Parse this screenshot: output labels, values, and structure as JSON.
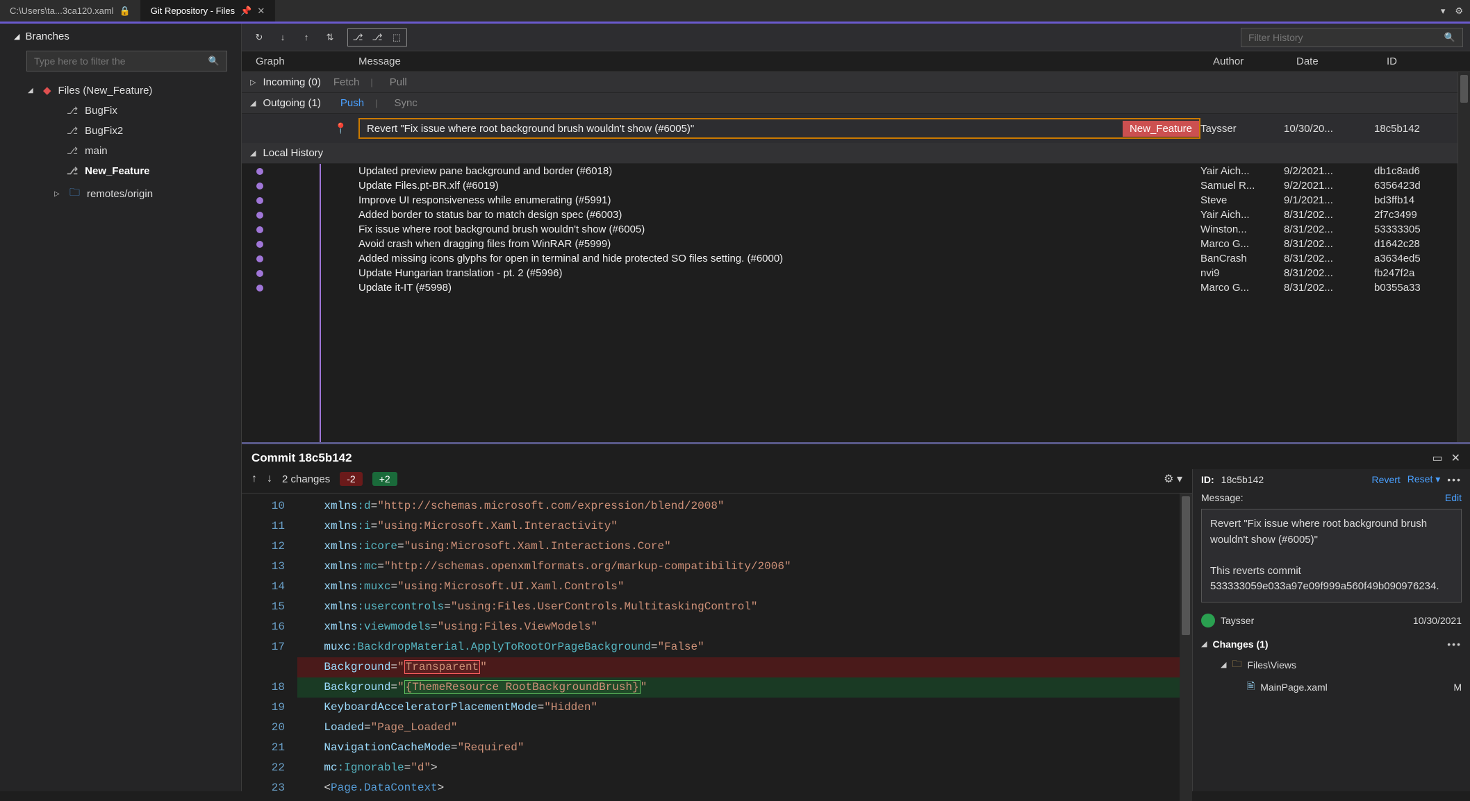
{
  "tabs": {
    "file_tab": "C:\\Users\\ta...3ca120.xaml",
    "repo_tab": "Git Repository - Files"
  },
  "branches": {
    "title": "Branches",
    "filter_placeholder": "Type here to filter the",
    "root_label": "Files (New_Feature)",
    "items": [
      "BugFix",
      "BugFix2",
      "main",
      "New_Feature"
    ],
    "remotes_label": "remotes/origin"
  },
  "toolbar": {
    "filter_history_placeholder": "Filter History"
  },
  "columns": {
    "graph": "Graph",
    "message": "Message",
    "author": "Author",
    "date": "Date",
    "id": "ID"
  },
  "sections": {
    "incoming_label": "Incoming (0)",
    "incoming_fetch": "Fetch",
    "incoming_pull": "Pull",
    "outgoing_label": "Outgoing (1)",
    "outgoing_push": "Push",
    "outgoing_sync": "Sync",
    "local_history": "Local History"
  },
  "outgoing_commit": {
    "message": "Revert \"Fix issue where root background brush wouldn't show (#6005)\"",
    "badge": "New_Feature",
    "author": "Taysser",
    "date": "10/30/20...",
    "id": "18c5b142"
  },
  "history": [
    {
      "message": "Updated preview pane background and border (#6018)",
      "author": "Yair Aich...",
      "date": "9/2/2021...",
      "id": "db1c8ad6"
    },
    {
      "message": "Update Files.pt-BR.xlf (#6019)",
      "author": "Samuel R...",
      "date": "9/2/2021...",
      "id": "6356423d"
    },
    {
      "message": "Improve UI responsiveness while enumerating (#5991)",
      "author": "Steve",
      "date": "9/1/2021...",
      "id": "bd3ffb14"
    },
    {
      "message": "Added border to status bar to match design spec (#6003)",
      "author": "Yair Aich...",
      "date": "8/31/202...",
      "id": "2f7c3499"
    },
    {
      "message": "Fix issue where root background brush wouldn't show (#6005)",
      "author": "Winston...",
      "date": "8/31/202...",
      "id": "53333305"
    },
    {
      "message": " Avoid crash when dragging files from WinRAR (#5999)",
      "author": "Marco G...",
      "date": "8/31/202...",
      "id": "d1642c28"
    },
    {
      "message": "Added missing icons glyphs for open in terminal and hide protected SO files setting. (#6000)",
      "author": "BanCrash",
      "date": "8/31/202...",
      "id": "a3634ed5"
    },
    {
      "message": "Update Hungarian translation - pt. 2 (#5996)",
      "author": "nvi9",
      "date": "8/31/202...",
      "id": "fb247f2a"
    },
    {
      "message": "Update it-IT (#5998)",
      "author": "Marco G...",
      "date": "8/31/202...",
      "id": "b0355a33"
    }
  ],
  "commit_details": {
    "title": "Commit 18c5b142",
    "changes_count_label": "2 changes",
    "minus_badge": "-2",
    "plus_badge": "+2",
    "id_label": "ID:",
    "id_value": "18c5b142",
    "revert": "Revert",
    "reset": "Reset",
    "message_label": "Message:",
    "edit": "Edit",
    "message_body": "Revert \"Fix issue where root background brush wouldn't show (#6005)\"\n\nThis reverts commit 533333059e033a97e09f999a560f49b090976234.",
    "author_name": "Taysser",
    "author_date": "10/30/2021",
    "changes_header": "Changes (1)",
    "folder_path": "Files\\Views",
    "file_name": "MainPage.xaml",
    "file_status": "M"
  },
  "diff": {
    "line_numbers": [
      "10",
      "11",
      "12",
      "13",
      "14",
      "15",
      "16",
      "17",
      "",
      "18",
      "19",
      "20",
      "21",
      "22",
      "23"
    ],
    "line10": {
      "pre": "    xmlns",
      "ns": ":d",
      "eq": "=",
      "str": "\"http://schemas.microsoft.com/expression/blend/2008\""
    },
    "line11": {
      "pre": "    xmlns",
      "ns": ":i",
      "eq": "=",
      "str": "\"using:Microsoft.Xaml.Interactivity\""
    },
    "line12": {
      "pre": "    xmlns",
      "ns": ":icore",
      "eq": "=",
      "str": "\"using:Microsoft.Xaml.Interactions.Core\""
    },
    "line13": {
      "pre": "    xmlns",
      "ns": ":mc",
      "eq": "=",
      "str": "\"http://schemas.openxmlformats.org/markup-compatibility/2006\""
    },
    "line14": {
      "pre": "    xmlns",
      "ns": ":muxc",
      "eq": "=",
      "str": "\"using:Microsoft.UI.Xaml.Controls\""
    },
    "line15": {
      "pre": "    xmlns",
      "ns": ":usercontrols",
      "eq": "=",
      "str": "\"using:Files.UserControls.MultitaskingControl\""
    },
    "line16": {
      "pre": "    xmlns",
      "ns": ":viewmodels",
      "eq": "=",
      "str": "\"using:Files.ViewModels\""
    },
    "line17": {
      "pre": "    muxc",
      "ns": ":BackdropMaterial.ApplyToRootOrPageBackground",
      "eq": "=",
      "str": "\"False\""
    },
    "removed": {
      "pre": "    Background",
      "eq": "=",
      "q1": "\"",
      "val": "Transparent",
      "q2": "\""
    },
    "added": {
      "pre": "    Background",
      "eq": "=",
      "q1": "\"",
      "val": "{ThemeResource RootBackgroundBrush}",
      "q2": "\""
    },
    "line19": {
      "pre": "    KeyboardAcceleratorPlacementMode",
      "eq": "=",
      "str": "\"Hidden\""
    },
    "line20": {
      "pre": "    Loaded",
      "eq": "=",
      "str": "\"Page_Loaded\""
    },
    "line21": {
      "pre": "    NavigationCacheMode",
      "eq": "=",
      "str": "\"Required\""
    },
    "line22": {
      "pre": "    mc",
      "ns": ":Ignorable",
      "eq": "=",
      "str": "\"d\"",
      "tail": ">"
    },
    "line23": {
      "open": "    <",
      "tag": "Page.DataContext",
      "close": ">"
    }
  }
}
